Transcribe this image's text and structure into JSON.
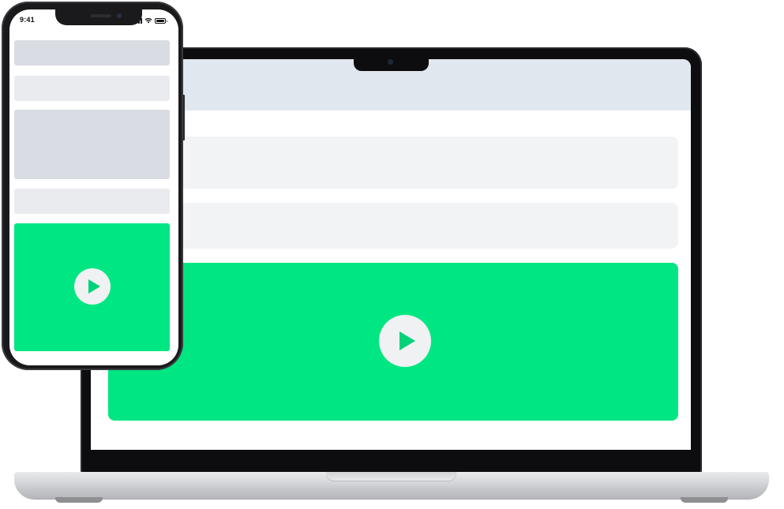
{
  "laptop": {
    "screen": {
      "header_bar": "",
      "content_blocks": 2,
      "video": {
        "accent_color": "#00e682",
        "play_icon": "play-icon"
      }
    }
  },
  "phone": {
    "status_bar": {
      "time": "9:41",
      "icons": [
        "signal-icon",
        "wifi-icon",
        "battery-icon"
      ]
    },
    "content_blocks": 4,
    "video": {
      "accent_color": "#00e682",
      "play_icon": "play-icon"
    }
  }
}
